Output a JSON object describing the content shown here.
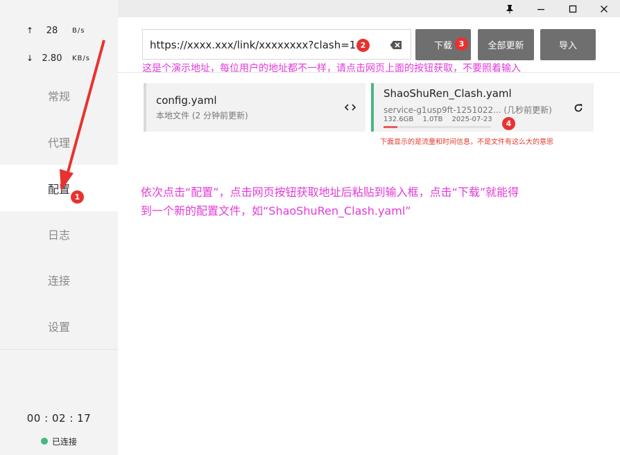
{
  "titlebar": {
    "pin_icon": "pin-icon",
    "minimize_icon": "minimize-icon",
    "maximize_icon": "maximize-icon",
    "close_icon": "close-icon"
  },
  "traffic": {
    "up_arrow": "↑",
    "up_value": "28",
    "up_unit": "B/s",
    "down_arrow": "↓",
    "down_value": "2.80",
    "down_unit": "KB/s"
  },
  "sidebar": {
    "items": [
      {
        "label": "常规"
      },
      {
        "label": "代理"
      },
      {
        "label": "配置"
      },
      {
        "label": "日志"
      },
      {
        "label": "连接"
      },
      {
        "label": "设置"
      }
    ],
    "active_index": 2
  },
  "status": {
    "timer": "00 : 02 : 17",
    "connection": "已连接",
    "connection_color": "#47b881"
  },
  "url_bar": {
    "value": "https://xxxx.xxx/link/xxxxxxxx?clash=1",
    "clear_icon": "backspace-clear-icon"
  },
  "buttons": {
    "download": "下载",
    "update_all": "全部更新",
    "import": "导入"
  },
  "profiles": [
    {
      "name": "config.yaml",
      "subtitle": "本地文件 (2 分钟前更新)",
      "action_icon": "code-brackets-icon"
    },
    {
      "name": "ShaoShuRen_Clash.yaml",
      "subtitle": "service-g1usp9ft-1251022... (几秒前更新)",
      "used": "132.6GB",
      "total": "1.0TB",
      "expires": "2025-07-23",
      "usage_fraction": 0.13,
      "action_icon": "refresh-icon",
      "accent_color": "#47b881"
    }
  ],
  "annotations": {
    "badges": [
      "1",
      "2",
      "3",
      "4"
    ],
    "demo_note": "这是个演示地址，每位用户的地址都不一样，请点击网页上面的按钮获取，不要照着输入",
    "info_note": "下面显示的是流量和时间信息，不是文件有这么大的意思",
    "steps_line1": "依次点击“配置”，点击网页按钮获取地址后粘贴到输入框，点击“下载”就能得",
    "steps_line2": "到一个新的配置文件，如“ShaoShuRen_Clash.yaml”",
    "note_color": "#e23ad8",
    "badge_color": "#e8322f"
  }
}
